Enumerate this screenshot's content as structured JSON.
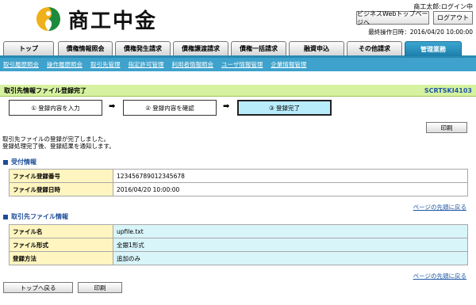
{
  "header": {
    "logo_text": "商工中金",
    "login_user": "商工太郎:ログイン中",
    "biz_button": "ビジネスWebトップページへ",
    "logout_button": "ログアウト",
    "last_operation": "最終操作日時：2016/04/20 10:00:00"
  },
  "tabs": [
    {
      "label": "トップ"
    },
    {
      "label": "債権情報照会"
    },
    {
      "label": "債権発生請求"
    },
    {
      "label": "債権譲渡請求"
    },
    {
      "label": "債権一括請求"
    },
    {
      "label": "融資申込"
    },
    {
      "label": "その他請求"
    },
    {
      "label": "管理業務",
      "active": true
    }
  ],
  "subnav": [
    "取引履歴照会",
    "操作履歴照会",
    "取引先管理",
    "指定許可管理",
    "利用者情報照会",
    "ユーザ情報管理",
    "企業情報管理"
  ],
  "page": {
    "title": "取引先情報ファイル登録完了",
    "screen_code": "SCRTSKI4103"
  },
  "steps": [
    "① 登録内容を入力",
    "② 登録内容を確認",
    "③ 登録完了"
  ],
  "step_arrow": "➡",
  "buttons": {
    "print": "印刷",
    "back_to_top": "トップへ戻る"
  },
  "message": {
    "line1": "取引先ファイルの登録が完了しました。",
    "line2": "登録処理完了後、登録結果を通知します。"
  },
  "reception": {
    "title": "受付情報",
    "rows": [
      {
        "label": "ファイル登録番号",
        "value": "12345678901234567​8"
      },
      {
        "label": "ファイル登録日時",
        "value": "2016/04/20 10:00:00"
      }
    ]
  },
  "file_info": {
    "title": "取引先ファイル情報",
    "rows": [
      {
        "label": "ファイル名",
        "value": "upfile.txt"
      },
      {
        "label": "ファイル形式",
        "value": "全銀1形式"
      },
      {
        "label": "登録方法",
        "value": "追加のみ"
      }
    ]
  },
  "link_to_top": "ページの先頭に戻る"
}
